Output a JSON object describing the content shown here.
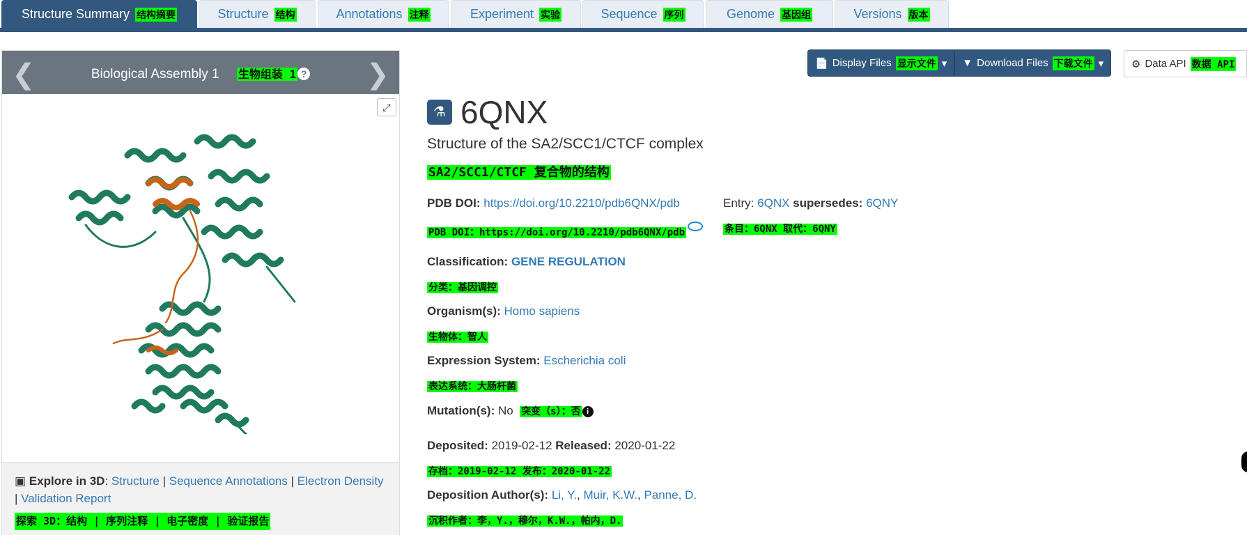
{
  "tabs": [
    {
      "label": "Structure Summary",
      "tr": "结构摘要",
      "active": true
    },
    {
      "label": "Structure",
      "tr": "结构",
      "active": false
    },
    {
      "label": "Annotations",
      "tr": "注释",
      "active": false
    },
    {
      "label": "Experiment",
      "tr": "实验",
      "active": false
    },
    {
      "label": "Sequence",
      "tr": "序列",
      "active": false
    },
    {
      "label": "Genome",
      "tr": "基因组",
      "active": false
    },
    {
      "label": "Versions",
      "tr": "版本",
      "active": false
    }
  ],
  "assembly": {
    "title": "Biological Assembly 1",
    "tr": "生物组装 1",
    "help": "?",
    "expand": "⤢"
  },
  "explore": {
    "label": "Explore in 3D",
    "links": [
      "Structure",
      "Sequence Annotations",
      "Electron Density",
      "Validation Report"
    ],
    "tr": "探索 3D：结构 | 序列注释 | 电子密度 | 验证报告"
  },
  "buttons": {
    "display_files": "Display Files",
    "display_files_tr": "显示文件",
    "download_files": "Download Files",
    "download_files_tr": "下载文件",
    "data_api": "Data API",
    "data_api_tr": "数据 API"
  },
  "entry": {
    "id": "6QNX",
    "title": "Structure of the SA2/SCC1/CTCF complex",
    "title_tr": "SA2/SCC1/CTCF 复合物的结构",
    "doi_label": "PDB DOI:",
    "doi": "https://doi.org/10.2210/pdb6QNX/pdb",
    "doi_tr": "PDB DOI：https://doi.org/10.2210/pdb6QNX/pdb",
    "entry_label": "Entry:",
    "entry_value": "6QNX",
    "supersedes_label": "supersedes:",
    "supersedes_value": "6QNY",
    "entry_tr": "条目：6QNX 取代：6QNY",
    "classification_label": "Classification:",
    "classification": "GENE REGULATION",
    "classification_tr": "分类：基因调控",
    "organism_label": "Organism(s):",
    "organism": "Homo sapiens",
    "organism_tr": "生物体：智人",
    "expression_label": "Expression System:",
    "expression": "Escherichia coli",
    "expression_tr": "表达系统：大肠杆菌",
    "mutation_label": "Mutation(s):",
    "mutation": "No",
    "mutation_tr": "突变（s）：否",
    "deposited_label": "Deposited:",
    "deposited": "2019-02-12",
    "released_label": "Released:",
    "released": "2020-01-22",
    "dates_tr": "存档：2019-02-12 发布：2020-01-22",
    "authors_label": "Deposition Author(s):",
    "authors": [
      "Li, Y.",
      "Muir, K.W.",
      "Panne, D."
    ],
    "authors_tr": "沉积作者：李，Y.，穆尔，K.W.，帕内，D."
  },
  "colors": {
    "primary": "#325880",
    "link": "#337ab7",
    "highlight": "#00ff00",
    "protein": "#1f7a5e",
    "chain": "#c8641a"
  },
  "icons": [
    "chevron-left-icon",
    "chevron-right-icon",
    "question-icon",
    "expand-icon",
    "cube-icon",
    "file-icon",
    "download-icon",
    "gear-icon",
    "flask-icon",
    "info-icon",
    "caret-down-icon",
    "pdb-logo-icon"
  ]
}
